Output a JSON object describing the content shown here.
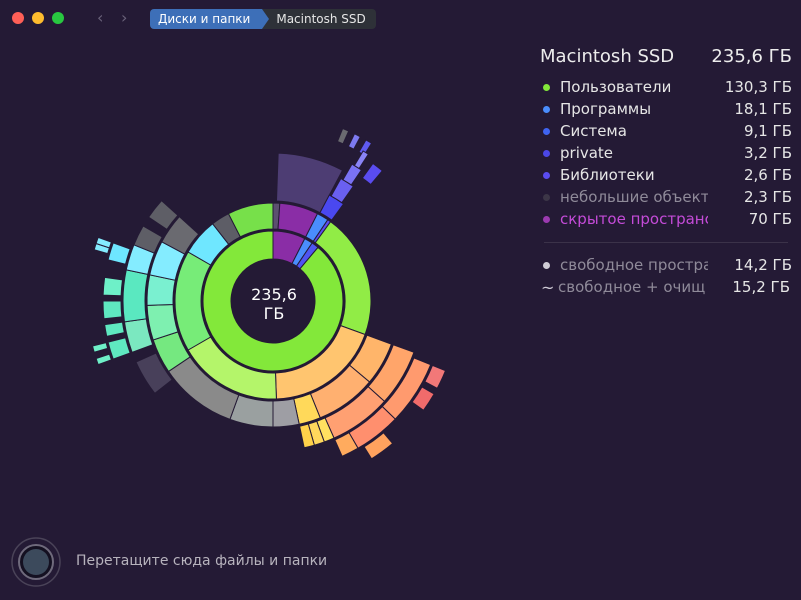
{
  "window": {
    "breadcrumbs": [
      "Диски и папки",
      "Macintosh SSD"
    ],
    "nav_back": "‹",
    "nav_forward": "›"
  },
  "center": {
    "value": "235,6",
    "unit": "ГБ"
  },
  "disk": {
    "name": "Macintosh SSD",
    "size": "235,6 ГБ"
  },
  "legend": [
    {
      "name": "Пользователи",
      "size": "130,3 ГБ",
      "color": "#83e83a",
      "style": "normal"
    },
    {
      "name": "Программы",
      "size": "18,1 ГБ",
      "color": "#4a8dfc",
      "style": "normal"
    },
    {
      "name": "Система",
      "size": "9,1 ГБ",
      "color": "#3f64f0",
      "style": "normal"
    },
    {
      "name": "private",
      "size": "3,2 ГБ",
      "color": "#4b47e6",
      "style": "normal"
    },
    {
      "name": "Библиотеки",
      "size": "2,6 ГБ",
      "color": "#5a4cf0",
      "style": "normal"
    },
    {
      "name": "небольшие объекты",
      "size": "2,3 ГБ",
      "color": "#3c3647",
      "style": "dim"
    },
    {
      "name": "скрытое пространство",
      "size": "70   ГБ",
      "color": "#9b3ab0",
      "style": "purple"
    }
  ],
  "free": [
    {
      "icon": "dot",
      "name": "свободное пространство",
      "size": "14,2 ГБ"
    },
    {
      "icon": "tilde",
      "name": "свободное + очищаемое",
      "size": "15,2 ГБ"
    }
  ],
  "drop_hint": "Перетащите сюда файлы и папки",
  "colors": {
    "background": "#241a35",
    "breadcrumb_active": "#3d6fb8"
  }
}
